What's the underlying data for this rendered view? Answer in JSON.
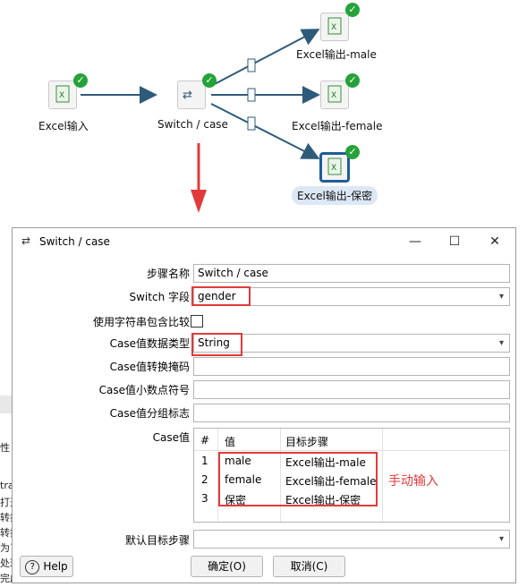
{
  "canvas": {
    "nodes": [
      {
        "label": "Excel输入"
      },
      {
        "label": "Switch / case"
      },
      {
        "label": "Excel输出-male"
      },
      {
        "label": "Excel输出-female"
      },
      {
        "label": "Excel输出-保密"
      }
    ]
  },
  "bg_fragments": [
    "tra",
    "打开",
    "转换",
    "转换",
    "为了",
    "处理",
    "完成",
    "性"
  ],
  "dialog": {
    "title": "Switch / case",
    "fields": {
      "step_name_label": "步骤名称",
      "step_name_value": "Switch / case",
      "switch_field_label": "Switch 字段",
      "switch_field_value": "gender",
      "contains_label": "使用字符串包含比较",
      "datatype_label": "Case值数据类型",
      "datatype_value": "String",
      "mask_label": "Case值转换掩码",
      "decimal_label": "Case值小数点符号",
      "group_label": "Case值分组标志",
      "case_values_label": "Case值",
      "default_target_label": "默认目标步骤"
    },
    "table": {
      "headers": [
        "#",
        "值",
        "目标步骤"
      ],
      "rows": [
        {
          "n": "1",
          "value": "male",
          "target": "Excel输出-male"
        },
        {
          "n": "2",
          "value": "female",
          "target": "Excel输出-female"
        },
        {
          "n": "3",
          "value": "保密",
          "target": "Excel输出-保密"
        }
      ]
    },
    "annotation": "手动输入",
    "buttons": {
      "help": "Help",
      "ok": "确定(O)",
      "cancel": "取消(C)"
    }
  }
}
